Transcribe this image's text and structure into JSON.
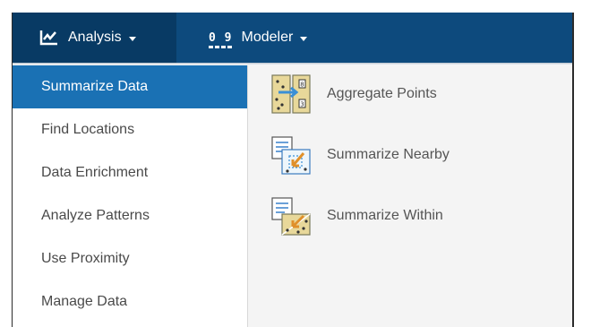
{
  "topbar": {
    "analysis": {
      "label": "Analysis",
      "icon": "line-chart-icon"
    },
    "modeler": {
      "label": "Modeler",
      "icon": "digits-icon",
      "icon_text": "0 9"
    },
    "colors": {
      "bar": "#0d4a7d",
      "active": "#083a64"
    }
  },
  "sidebar": {
    "items": [
      {
        "label": "Summarize Data",
        "active": true
      },
      {
        "label": "Find Locations"
      },
      {
        "label": "Data Enrichment"
      },
      {
        "label": "Analyze Patterns"
      },
      {
        "label": "Use Proximity"
      },
      {
        "label": "Manage Data"
      }
    ],
    "colors": {
      "active_bg": "#1a71b4"
    }
  },
  "tools": [
    {
      "label": "Aggregate Points",
      "icon": "aggregate-points-icon"
    },
    {
      "label": "Summarize Nearby",
      "icon": "summarize-nearby-icon"
    },
    {
      "label": "Summarize Within",
      "icon": "summarize-within-icon"
    }
  ]
}
